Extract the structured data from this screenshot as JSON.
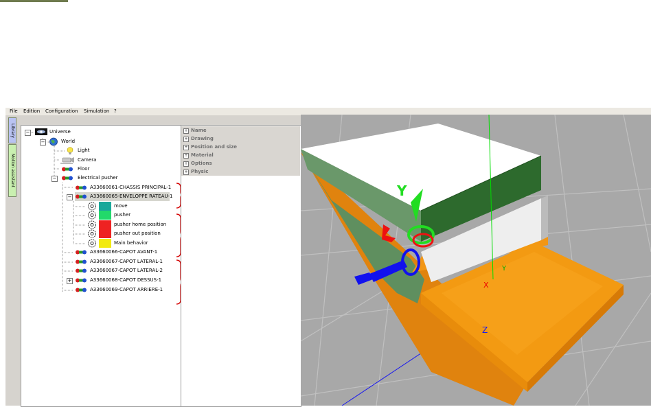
{
  "window": {
    "menu": [
      "File",
      "Edition",
      "Configuration",
      "Simulation",
      "?"
    ]
  },
  "side_tabs": {
    "library": "Library",
    "motion_assistant": "Motion assistant"
  },
  "tree": {
    "universe": "Universe",
    "world": "World",
    "light": "Light",
    "camera": "Camera",
    "floor": "Floor",
    "electrical_pusher": "Electrical pusher",
    "components": [
      "A33660061-CHASSIS PRINCIPAL-1",
      "A33660065-ENVELOPPE RATEAU-1",
      "A33660066-CAPOT AVANT-1",
      "A33660067-CAPOT LATERAL-1",
      "A33660067-CAPOT LATERAL-2",
      "A33660068-CAPOT DESSUS-1",
      "A33660069-CAPOT ARRIERE-1"
    ],
    "behaviors": [
      {
        "label": "move",
        "color": "#1aa89a"
      },
      {
        "label": "pusher",
        "color": "#22d96a"
      },
      {
        "label": "pusher home position",
        "color": "#ee2222"
      },
      {
        "label": "pusher out position",
        "color": "#ee2222"
      },
      {
        "label": "Main behavior",
        "color": "#f2ea10"
      }
    ]
  },
  "properties": [
    "Name",
    "Drawing",
    "Position and size",
    "Material",
    "Options",
    "Physic"
  ],
  "viewport": {
    "axis_labels": {
      "y_gizmo": "Y",
      "x_small": "X",
      "y_small": "Y",
      "z": "Z"
    },
    "colors": {
      "floor": "#a8a8a8",
      "grid": "#bdbdbd",
      "green_axis": "#00dd00",
      "blue_axis": "#0000ee",
      "red_axis": "#ee0000",
      "orange": "#f39a12"
    }
  }
}
